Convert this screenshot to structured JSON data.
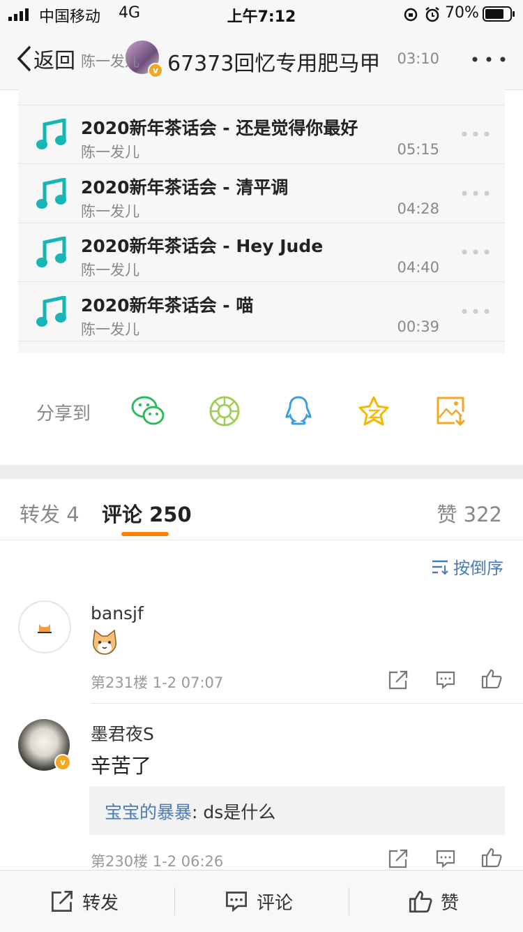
{
  "status": {
    "carrier": "中国移动",
    "network": "4G",
    "time": "上午7:12",
    "battery": "70%"
  },
  "nav": {
    "back_label": "返回",
    "title": "67373回忆专用肥马甲"
  },
  "songs": [
    {
      "title": "2020新年茶话会 - 还是觉得你最好",
      "artist": "陈一发儿",
      "duration": "05:15"
    },
    {
      "title": "2020新年茶话会 - 清平调",
      "artist": "陈一发儿",
      "duration": "04:28"
    },
    {
      "title": "2020新年茶话会 - Hey Jude",
      "artist": "陈一发儿",
      "duration": "04:40"
    },
    {
      "title": "2020新年茶话会 - 喵",
      "artist": "陈一发儿",
      "duration": "00:39"
    }
  ],
  "partial_song": {
    "artist": "陈一发儿",
    "duration": "03:10"
  },
  "share": {
    "label": "分享到",
    "targets": [
      "wechat-icon",
      "moments-icon",
      "qq-icon",
      "qzone-icon",
      "save-image-icon"
    ]
  },
  "tabs": {
    "repost": "转发 4",
    "comments": "评论 250",
    "likes": "赞 322"
  },
  "sort_label": "按倒序",
  "comments": [
    {
      "user": "bansjf",
      "text": "",
      "meta": "第231楼 1-2 07:07"
    },
    {
      "user": "墨君夜S",
      "text": "辛苦了",
      "reply_user": "宝宝的暴暴",
      "reply_text": ": ds是什么",
      "meta": "第230楼 1-2 06:26"
    }
  ],
  "bottom": {
    "repost": "转发",
    "comment": "评论",
    "like": "赞"
  },
  "colors": {
    "accent": "#ff8200",
    "link": "#4b7bb5",
    "music_icon": "#17b6b6"
  }
}
